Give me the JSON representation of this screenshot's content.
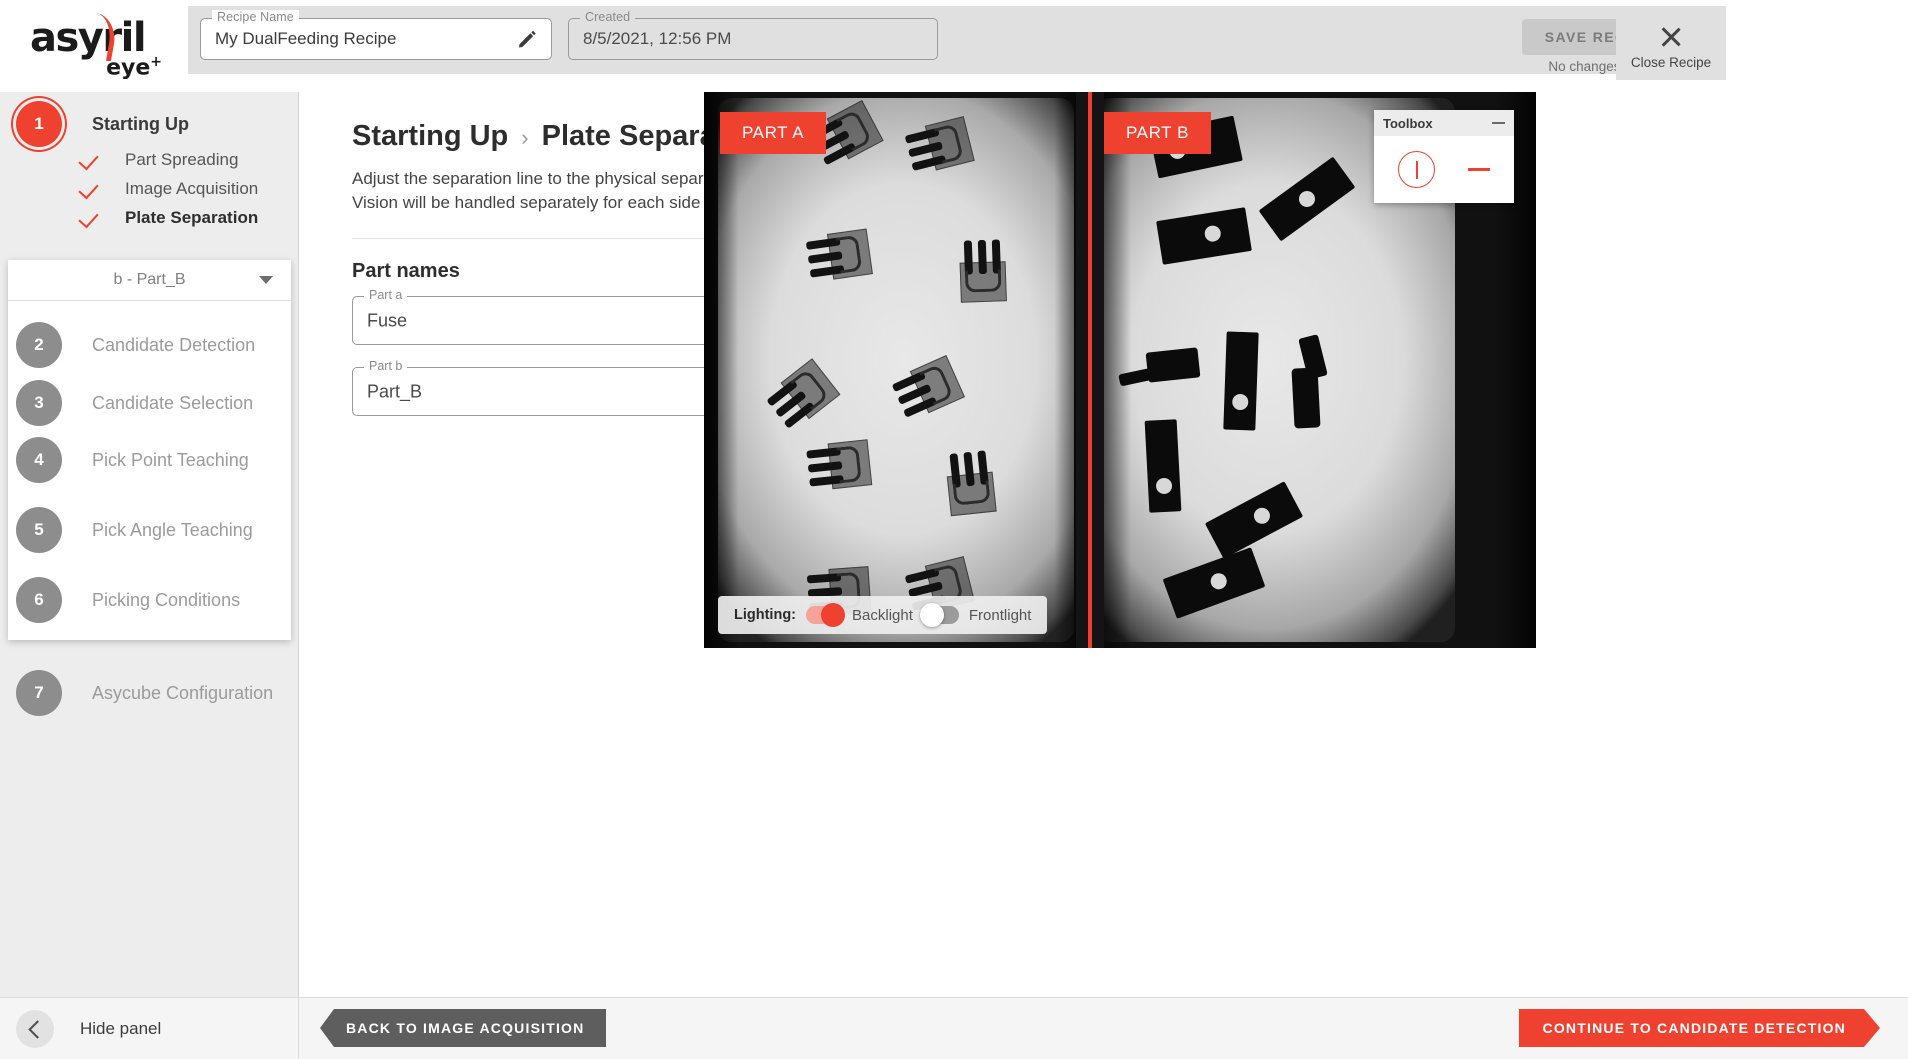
{
  "header": {
    "logo_text": "asyril",
    "logo_sub": "eye",
    "logo_sup": "+",
    "recipe_name_label": "Recipe Name",
    "recipe_name_value": "My DualFeeding Recipe",
    "created_label": "Created",
    "created_value": "8/5/2021, 12:56 PM",
    "save_label": "SAVE RECIPE",
    "no_changes_text": "No changes detected",
    "close_label": "Close Recipe",
    "accent_color": "#ee4130"
  },
  "sidebar": {
    "steps": [
      {
        "number": "1",
        "label": "Starting Up",
        "active": true
      },
      {
        "number": "2",
        "label": "Candidate Detection",
        "active": false
      },
      {
        "number": "3",
        "label": "Candidate Selection",
        "active": false
      },
      {
        "number": "4",
        "label": "Pick Point Teaching",
        "active": false
      },
      {
        "number": "5",
        "label": "Pick Angle Teaching",
        "active": false
      },
      {
        "number": "6",
        "label": "Picking Conditions",
        "active": false
      },
      {
        "number": "7",
        "label": "Asycube Configuration",
        "active": false
      }
    ],
    "substeps": [
      {
        "label": "Part Spreading",
        "checked": true,
        "current": false
      },
      {
        "label": "Image Acquisition",
        "checked": true,
        "current": false
      },
      {
        "label": "Plate Separation",
        "checked": true,
        "current": true
      }
    ],
    "part_selector_value": "b - Part_B"
  },
  "main": {
    "breadcrumb_parent": "Starting Up",
    "breadcrumb_separator": "›",
    "breadcrumb_current": "Plate Separation",
    "description_line1": "Adjust the separation line to the physical separation on the plate.",
    "description_line2": "Vision will be handled separately for each side of the plate.",
    "section_title": "Part names",
    "info_icon_glyph": "i",
    "part_a_label": "Part a",
    "part_a_value": "Fuse",
    "part_b_label": "Part b",
    "part_b_value": "Part_B"
  },
  "viewer": {
    "part_a_badge": "PART A",
    "part_b_badge": "PART B",
    "lighting_label": "Lighting:",
    "backlight_label": "Backlight",
    "backlight_on": true,
    "frontlight_label": "Frontlight",
    "frontlight_on": false,
    "separation_line_color": "#f04030"
  },
  "toolbox": {
    "title": "Toolbox",
    "tools": [
      {
        "name": "vertical-separation-line-tool",
        "selected": true
      },
      {
        "name": "horizontal-separation-line-tool",
        "selected": false
      }
    ]
  },
  "footer": {
    "hide_panel_label": "Hide panel",
    "back_label": "BACK TO IMAGE ACQUISITION",
    "continue_label": "CONTINUE TO CANDIDATE DETECTION"
  }
}
